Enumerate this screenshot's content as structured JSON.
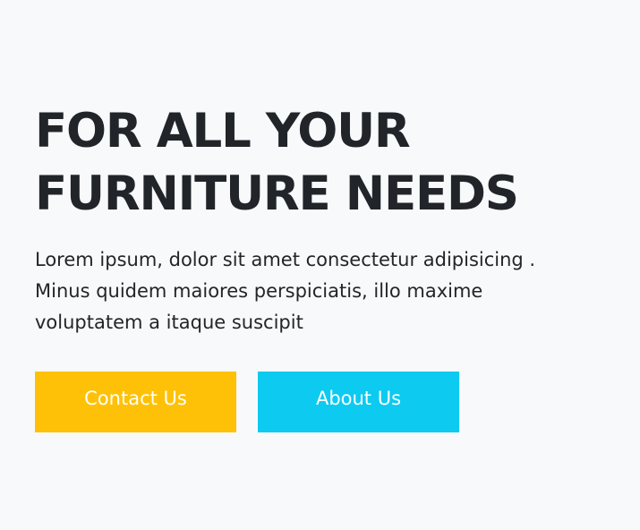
{
  "hero": {
    "heading_line1": "FOR ALL YOUR",
    "heading_line2": "FURNITURE NEEDS",
    "text_line1": "Lorem ipsum, dolor sit amet consectetur adipisicing .",
    "text_line2": "Minus quidem maiores perspiciatis, illo maxime",
    "text_line3": "voluptatem a itaque suscipit"
  },
  "buttons": {
    "contact_label": "Contact Us",
    "about_label": "About Us"
  },
  "colors": {
    "background": "#f8f9fb",
    "heading": "#212529",
    "contact_button": "#ffc107",
    "about_button": "#0dcaf0",
    "button_text": "#ffffff"
  }
}
